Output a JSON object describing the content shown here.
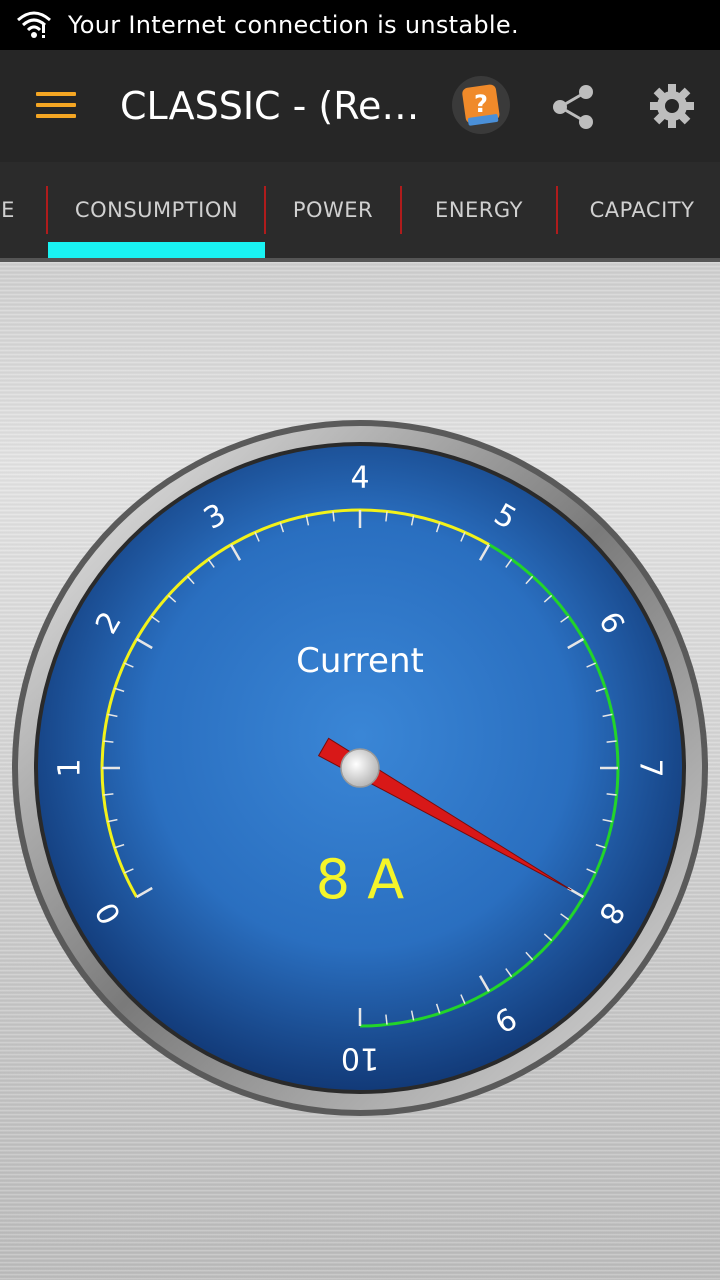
{
  "status_bar": {
    "message": "Your Internet connection is unstable.",
    "icon": "wifi-warning-icon"
  },
  "toolbar": {
    "title": "CLASSIC - (Res...",
    "menu_icon": "hamburger-menu-icon",
    "help_icon": "help-book-icon",
    "share_icon": "share-icon",
    "settings_icon": "gear-icon"
  },
  "tabs": [
    {
      "label": "E"
    },
    {
      "label": "CONSUMPTION",
      "active": true
    },
    {
      "label": "POWER"
    },
    {
      "label": "ENERGY"
    },
    {
      "label": "CAPACITY"
    }
  ],
  "gauge": {
    "label": "Current",
    "readout": "8 A",
    "min": 0,
    "max": 10,
    "value": 8,
    "tick_labels": [
      "0",
      "1",
      "2",
      "3",
      "4",
      "5",
      "6",
      "7",
      "8",
      "9",
      "10"
    ],
    "low_arc_range": [
      0,
      5
    ],
    "high_arc_range": [
      5,
      10
    ],
    "colors": {
      "low_arc": "#f2f21a",
      "high_arc": "#22d42a",
      "needle": "#d81818",
      "readout": "#f5f52a",
      "dial": "#2a74c4"
    }
  }
}
